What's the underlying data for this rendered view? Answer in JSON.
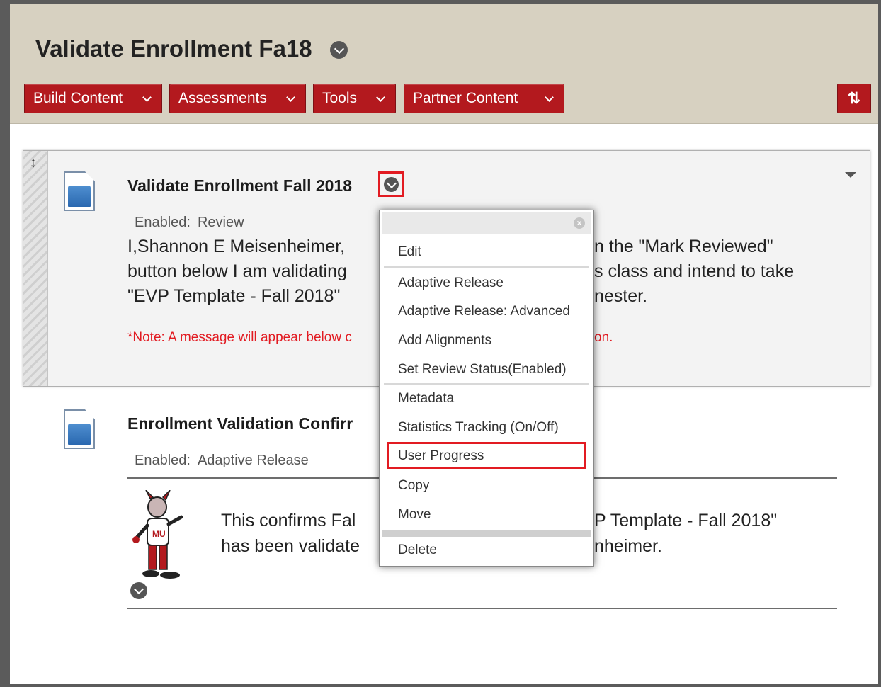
{
  "header": {
    "title": "Validate Enrollment Fa18",
    "toolbar": {
      "build_content": "Build Content",
      "assessments": "Assessments",
      "tools": "Tools",
      "partner_content": "Partner Content",
      "sort_icon": "⇅"
    }
  },
  "items": [
    {
      "title": "Validate Enrollment Fall 2018",
      "status_label": "Enabled:",
      "status_value": "Review",
      "body_lines": [
        "I,Shannon E Meisenheimer,",
        "button below I am validating",
        "\"EVP Template - Fall 2018\""
      ],
      "body_right": [
        "n the \"Mark Reviewed\"",
        "s class and intend to take",
        "nester."
      ],
      "note_left": "*Note: A message will appear below c",
      "note_right": "on."
    },
    {
      "title": "Enrollment Validation Confirr",
      "status_label": "Enabled:",
      "status_value": "Adaptive Release",
      "body_lines": [
        "This confirms Fal",
        "has been validate"
      ],
      "body_right": [
        "P Template - Fall 2018\"",
        "nheimer."
      ]
    }
  ],
  "context_menu": {
    "items": [
      "Edit",
      "Adaptive Release",
      "Adaptive Release: Advanced",
      "Add Alignments",
      "Set Review Status(Enabled)",
      "Metadata",
      "Statistics Tracking (On/Off)",
      "User Progress",
      "Copy",
      "Move",
      "Delete"
    ],
    "highlighted": "User Progress"
  },
  "colors": {
    "header_bg": "#d7d1c1",
    "button_red": "#b3191e",
    "highlight_red": "#e21b22"
  }
}
